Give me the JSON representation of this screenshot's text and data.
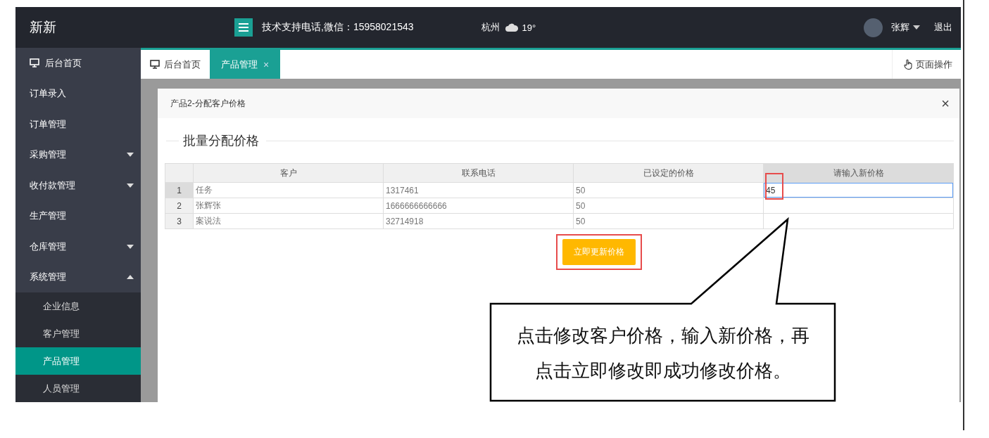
{
  "header": {
    "brand": "新新",
    "support_text": "技术支持电话,微信：15958021543",
    "city": "杭州",
    "temperature": "19°",
    "user_name": "张辉",
    "logout": "退出"
  },
  "sidebar": {
    "items": [
      {
        "label": "后台首页",
        "kind": "home",
        "selected": false
      },
      {
        "label": "订单录入",
        "kind": "link",
        "selected": false
      },
      {
        "label": "订单管理",
        "kind": "link",
        "selected": false
      },
      {
        "label": "采购管理",
        "kind": "group",
        "selected": false,
        "expanded": false
      },
      {
        "label": "收付款管理",
        "kind": "group",
        "selected": false,
        "expanded": false
      },
      {
        "label": "生产管理",
        "kind": "link",
        "selected": false
      },
      {
        "label": "仓库管理",
        "kind": "group",
        "selected": false,
        "expanded": false
      },
      {
        "label": "系统管理",
        "kind": "group",
        "selected": false,
        "expanded": true,
        "children": [
          {
            "label": "企业信息",
            "selected": false
          },
          {
            "label": "客户管理",
            "selected": false
          },
          {
            "label": "产品管理",
            "selected": true
          },
          {
            "label": "人员管理",
            "selected": false
          }
        ]
      }
    ]
  },
  "tabs": [
    {
      "label": "后台首页",
      "kind": "home",
      "selected": false
    },
    {
      "label": "产品管理",
      "kind": "closable",
      "selected": true,
      "close": "×"
    }
  ],
  "page_actions": "页面操作",
  "modal": {
    "title": "产品2-分配客户价格",
    "close": "×",
    "section_title": "批量分配价格",
    "table": {
      "columns": [
        {
          "label": "客户",
          "active": false
        },
        {
          "label": "联系电话",
          "active": false
        },
        {
          "label": "已设定的价格",
          "active": false
        },
        {
          "label": "请输入新价格",
          "active": true
        }
      ],
      "rows": [
        {
          "index": "1",
          "customer": "任务",
          "phone": "1317461",
          "price": "50",
          "new_price": "45",
          "active": true,
          "highlighted": true
        },
        {
          "index": "2",
          "customer": "张辉张",
          "phone": "1666666666666",
          "price": "50",
          "new_price": "",
          "active": false,
          "highlighted": false
        },
        {
          "index": "3",
          "customer": "案说法",
          "phone": "32714918",
          "price": "50",
          "new_price": "",
          "active": false,
          "highlighted": false
        }
      ]
    },
    "button": {
      "label": "立即更新价格",
      "highlighted": true
    }
  },
  "callout": {
    "text": "点击修改客户价格，输入新价格，再点击立即修改即成功修改价格。"
  }
}
